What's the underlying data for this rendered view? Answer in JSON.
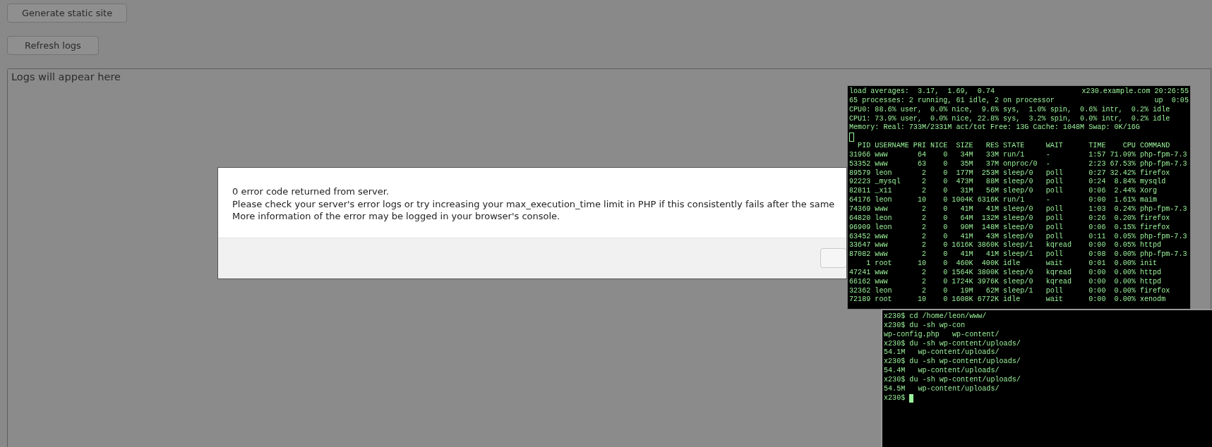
{
  "page": {
    "buttons": [
      {
        "label": "Generate static site"
      },
      {
        "label": "Refresh logs"
      }
    ],
    "logs": {
      "placeholder": "Logs will appear here"
    }
  },
  "dialog": {
    "lines": [
      "0 error code returned from server.",
      "Please check your server's error logs or try increasing your max_execution_time limit in PHP if this consistently fails after the same",
      "More information of the error may be logged in your browser's console."
    ]
  },
  "top_terminal": {
    "status": [
      {
        "left": "load averages:  3.17,  1.69,  0.74",
        "right": "x230.example.com 20:26:55"
      },
      {
        "left": "65 processes: 2 running, 61 idle, 2 on processor",
        "right": "up  0:05"
      },
      {
        "left": "CPU0: 88.6% user,  0.0% nice,  9.6% sys,  1.0% spin,  0.6% intr,  0.2% idle"
      },
      {
        "left": "CPU1: 73.9% user,  0.0% nice, 22.8% sys,  3.2% spin,  0.0% intr,  0.2% idle"
      },
      {
        "left": "Memory: Real: 733M/2331M act/tot Free: 13G Cache: 1048M Swap: 0K/16G"
      }
    ],
    "header": "  PID USERNAME PRI NICE  SIZE   RES STATE     WAIT      TIME    CPU COMMAND",
    "rows": [
      "31966 www       64    0   34M   33M run/1     -         1:57 71.09% php-fpm-7.3",
      "53352 www       63    0   35M   37M onproc/0  -         2:23 67.53% php-fpm-7.3",
      "89579 leon       2    0  177M  253M sleep/0   poll      0:27 32.42% firefox",
      "92223 _mysql     2    0  473M   88M sleep/0   poll      0:24  8.84% mysqld",
      "82811 _x11       2    0   31M   56M sleep/0   poll      0:06  2.44% Xorg",
      "64176 leon      10    0 1004K 6316K run/1     -         0:00  1.61% maim",
      "74369 www        2    0   41M   41M sleep/0   poll      1:03  0.24% php-fpm-7.3",
      "64820 leon       2    0   64M  132M sleep/0   poll      0:26  0.20% firefox",
      "96909 leon       2    0   90M  148M sleep/0   poll      0:06  0.15% firefox",
      "63452 www        2    0   41M   43M sleep/0   poll      0:11  0.05% php-fpm-7.3",
      "33647 www        2    0 1616K 3860K sleep/1   kqread    0:00  0.05% httpd",
      "87082 www        2    0   41M   41M sleep/1   poll      0:08  0.00% php-fpm-7.3",
      "    1 root      10    0  460K  400K idle      wait      0:01  0.00% init",
      "47241 www        2    0 1564K 3800K sleep/0   kqread    0:00  0.00% httpd",
      "66162 www        2    0 1724K 3976K sleep/0   kqread    0:00  0.00% httpd",
      "32362 leon       2    0   19M   62M sleep/1   poll      0:00  0.00% firefox",
      "72189 root      10    0 1608K 6772K idle      wait      0:00  0.00% xenodm"
    ]
  },
  "bottom_terminal": {
    "lines": [
      "x230$ cd /home/leon/www/",
      "x230$ du -sh wp-con",
      "wp-config.php   wp-content/",
      "x230$ du -sh wp-content/uploads/",
      "54.1M   wp-content/uploads/",
      "x230$ du -sh wp-content/uploads/",
      "54.4M   wp-content/uploads/",
      "x230$ du -sh wp-content/uploads/",
      "54.5M   wp-content/uploads/"
    ],
    "prompt": "x230$ "
  }
}
